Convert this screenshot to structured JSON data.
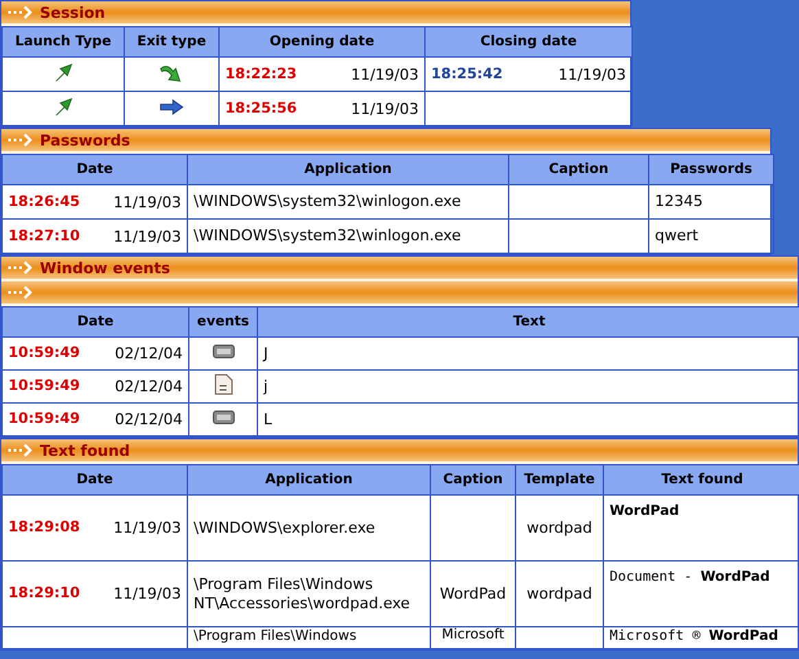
{
  "panels": [
    {
      "kind": "session",
      "title": "Session",
      "columns": [
        "Launch Type",
        "Exit type",
        "Opening date",
        "Closing date"
      ],
      "rows": [
        [
          {
            "kind": "launch"
          },
          {
            "kind": "curve"
          },
          {
            "kind": "datetime",
            "time": "18:22:23",
            "date": "11/19/03",
            "color": "#dd0000"
          },
          {
            "kind": "datetime",
            "time": "18:25:42",
            "date": "11/19/03",
            "color": "#224499"
          }
        ],
        [
          {
            "kind": "launch"
          },
          {
            "kind": "right"
          },
          {
            "kind": "datetime",
            "time": "18:25:56",
            "date": "11/19/03",
            "color": "#dd0000"
          },
          {
            "kind": "empty"
          }
        ]
      ]
    },
    {
      "kind": "passwords",
      "title": "Passwords",
      "columns": [
        "Date",
        "Application",
        "Caption",
        "Passwords"
      ],
      "rows": [
        [
          {
            "kind": "datetime",
            "time": "18:26:45",
            "date": "11/19/03",
            "color": "#dd0000"
          },
          {
            "kind": "text",
            "text": "\\WINDOWS\\system32\\winlogon.exe"
          },
          {
            "kind": "empty"
          },
          {
            "kind": "text",
            "text": "12345"
          }
        ],
        [
          {
            "kind": "datetime",
            "time": "18:27:10",
            "date": "11/19/03",
            "color": "#dd0000"
          },
          {
            "kind": "text",
            "text": "\\WINDOWS\\system32\\winlogon.exe"
          },
          {
            "kind": "empty"
          },
          {
            "kind": "text",
            "text": "qwert"
          }
        ]
      ]
    },
    {
      "kind": "events",
      "title": "Window events",
      "columns": [
        "Date",
        "events",
        "Text"
      ],
      "rows": [
        [
          {
            "kind": "datetime",
            "time": "10:59:49",
            "date": "02/12/04",
            "color": "#dd0000"
          },
          {
            "kind": "button"
          },
          {
            "kind": "text",
            "text": "J"
          }
        ],
        [
          {
            "kind": "datetime",
            "time": "10:59:49",
            "date": "02/12/04",
            "color": "#dd0000"
          },
          {
            "kind": "document"
          },
          {
            "kind": "text",
            "text": "j"
          }
        ],
        [
          {
            "kind": "datetime",
            "time": "10:59:49",
            "date": "02/12/04",
            "color": "#dd0000"
          },
          {
            "kind": "button"
          },
          {
            "kind": "text",
            "text": "L"
          }
        ]
      ]
    },
    {
      "kind": "found",
      "title": "Text found",
      "columns": [
        "Date",
        "Application",
        "Caption",
        "Template",
        "Text found"
      ],
      "rows": [
        [
          {
            "kind": "datetime",
            "time": "18:29:08",
            "date": "11/19/03",
            "color": "#dd0000"
          },
          {
            "kind": "text",
            "text": "\\WINDOWS\\explorer.exe"
          },
          {
            "kind": "empty"
          },
          {
            "kind": "text",
            "text": "wordpad"
          },
          {
            "kind": "found",
            "text": "WordPad",
            "bold": true
          }
        ],
        [
          {
            "kind": "datetime",
            "time": "18:29:10",
            "date": "11/19/03",
            "color": "#dd0000"
          },
          {
            "kind": "text",
            "text": "\\Program Files\\Windows NT\\Accessories\\wordpad.exe"
          },
          {
            "kind": "text",
            "text": "WordPad"
          },
          {
            "kind": "text",
            "text": "wordpad"
          },
          {
            "kind": "found",
            "text": "Document - **WordPad**",
            "bold": false
          }
        ],
        [
          {
            "kind": "empty"
          },
          {
            "kind": "text",
            "text": "\\Program Files\\Windows"
          },
          {
            "kind": "text",
            "text": "Microsoft"
          },
          {
            "kind": "empty"
          },
          {
            "kind": "found",
            "text": "Microsoft ® **WordPad**",
            "bold": false
          }
        ]
      ]
    }
  ]
}
